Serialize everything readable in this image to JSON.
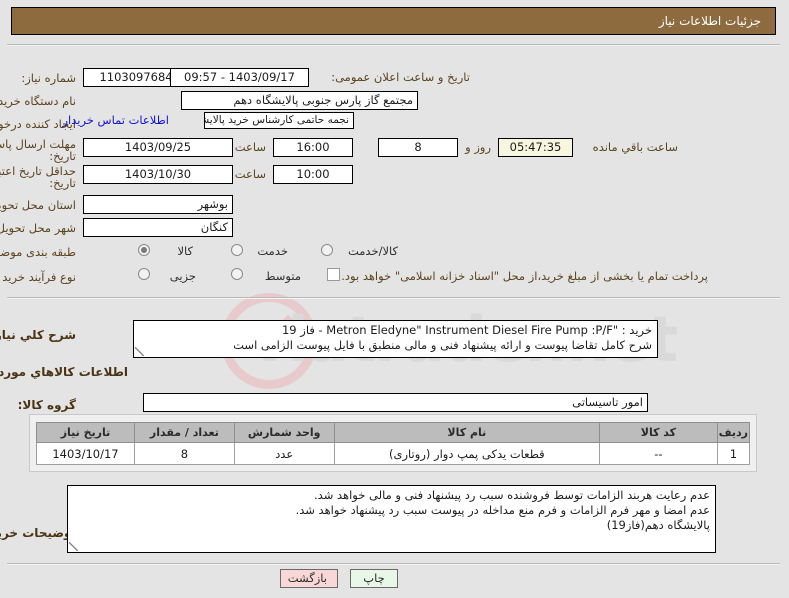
{
  "header": {
    "title": "جزئیات اطلاعات نیاز"
  },
  "form": {
    "need_number_label": "شماره نیاز:",
    "need_number_value": "1103097684000654",
    "announce_datetime_label": "تاریخ و ساعت اعلان عمومی:",
    "announce_datetime_value": "1403/09/17 - 09:57",
    "buyer_org_label": "نام دستگاه خریدار:",
    "buyer_org_value": "مجتمع گاز پارس جنوبی  پالایشگاه دهم",
    "requester_label": "ایجاد کننده درخواست:",
    "requester_value": "نجمه حاتمی کارشناس خرید پالایشگاه دهم  مجتمع گاز پارس جنوبی  پالایشگاه",
    "buyer_contact_link": "اطلاعات تماس خریدار",
    "response_deadline_label_1": "مهلت ارسال پاسخ: تا",
    "response_deadline_label_2": "تاریخ:",
    "response_deadline_date": "1403/09/25",
    "hour_label": "ساعت",
    "response_deadline_time": "16:00",
    "remaining_days": "8",
    "remaining_days_label": "روز و",
    "remaining_time": "05:47:35",
    "remaining_time_label": "ساعت باقي مانده",
    "price_validity_label_1": "حداقل تاریخ اعتبار قیمت: تا",
    "price_validity_label_2": "تاریخ:",
    "price_validity_date": "1403/10/30",
    "price_validity_time": "10:00",
    "province_label": "استان محل تحویل:",
    "province_value": "بوشهر",
    "city_label": "شهر محل تحویل:",
    "city_value": "کنگان",
    "category_label": "طبقه بندی موضوعی:",
    "category_options": [
      "کالا",
      "خدمت",
      "کالا/خدمت"
    ],
    "category_selected": "کالا",
    "process_type_label": "نوع فرآیند خرید :",
    "process_options": [
      "جزیی",
      "متوسط"
    ],
    "process_selected": "",
    "treasury_note": "پرداخت تمام یا بخشی از مبلغ خرید،از محل \"اسناد خزانه اسلامی\" خواهد بود.",
    "treasury_checked": false
  },
  "description": {
    "label": "شرح کلي نیاز:",
    "lines": [
      "خرید : \"Metron Eledyne\" Instrument Diesel Fire Pump :P/F - فاز 19",
      "شرح کامل تقاضا پیوست و ارائه پیشنهاد فنی و مالی منطبق با فایل پیوست الزامی است"
    ]
  },
  "goods_section": {
    "title": "اطلاعات کالاهاي مورد نیاز",
    "group_label": "گروه کالا:",
    "group_value": "امور تاسیساتی",
    "columns": [
      "ردیف",
      "کد کالا",
      "نام کالا",
      "واحد شمارش",
      "تعداد / مقدار",
      "تاریخ نیاز"
    ],
    "rows": [
      {
        "row_no": "1",
        "item_code": "--",
        "item_name": "قطعات یدکی پمپ دوار (روتاری)",
        "unit": "عدد",
        "quantity": "8",
        "need_date": "1403/10/17"
      }
    ]
  },
  "buyer_notes": {
    "label": "توضیحات خریدار:",
    "lines": [
      "عدم رعایت هربند الزامات توسط فروشنده سبب رد پیشنهاد فنی و مالی خواهد شد.",
      "عدم امضا و مهر فرم الزامات و فرم منع مداخله در پیوست سبب رد پیشنهاد خواهد شد.",
      "پالایشگاه دهم(فاز19)"
    ]
  },
  "footer": {
    "back_button": "بازگشت",
    "print_button": "چاپ"
  },
  "watermark": {
    "text": "viatrader.net"
  }
}
